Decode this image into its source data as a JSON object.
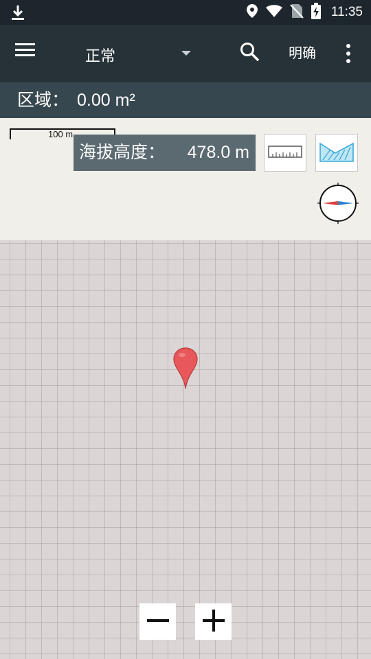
{
  "status_bar": {
    "time": "11:35",
    "icons": [
      "download-icon",
      "location-icon",
      "wifi-icon",
      "no-sim-icon",
      "battery-charging-icon"
    ]
  },
  "app_bar": {
    "menu_icon": "hamburger-menu-icon",
    "mode_label": "正常",
    "search_icon": "search-icon",
    "confirm_label": "明确",
    "more_icon": "more-vert-icon"
  },
  "area_bar": {
    "label": "区域：",
    "value": "0.00 m²"
  },
  "map": {
    "scale_label": "100 m",
    "elevation_label": "海拔高度：",
    "elevation_value": "478.0 m",
    "ruler_icon": "ruler-icon",
    "profile_icon": "elevation-profile-icon",
    "compass_icon": "compass-icon",
    "marker_icon": "map-pin-icon",
    "marker_color": "#e8585a",
    "zoom_out_icon": "minus-icon",
    "zoom_in_icon": "plus-icon"
  },
  "colors": {
    "status_bar": "#1c262c",
    "app_bar": "#263238",
    "area_bar": "#37474f",
    "elevation_box": "#5b6a71",
    "map_background": "#dcd5d5",
    "profile_accent": "#3aa8d6"
  }
}
